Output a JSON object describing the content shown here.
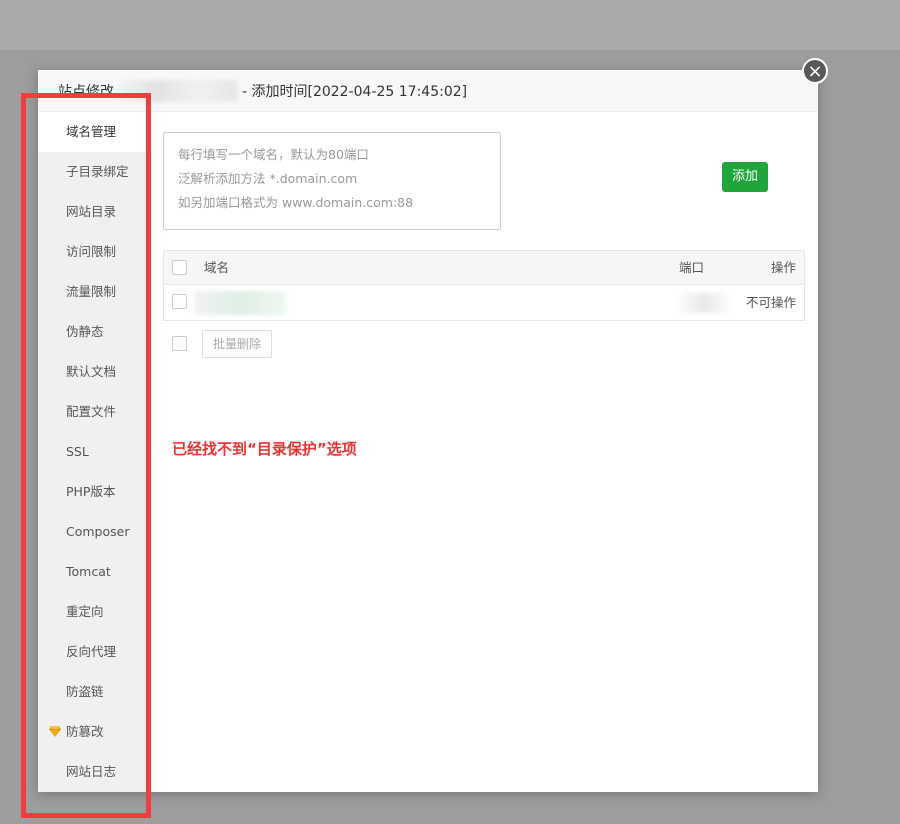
{
  "dialog": {
    "title_prefix": "站点修改",
    "title_suffix": "- 添加时间[2022-04-25 17:45:02]",
    "close_icon": "×"
  },
  "sidebar": {
    "items": [
      {
        "label": "域名管理"
      },
      {
        "label": "子目录绑定"
      },
      {
        "label": "网站目录"
      },
      {
        "label": "访问限制"
      },
      {
        "label": "流量限制"
      },
      {
        "label": "伪静态"
      },
      {
        "label": "默认文档"
      },
      {
        "label": "配置文件"
      },
      {
        "label": "SSL"
      },
      {
        "label": "PHP版本"
      },
      {
        "label": "Composer"
      },
      {
        "label": "Tomcat"
      },
      {
        "label": "重定向"
      },
      {
        "label": "反向代理"
      },
      {
        "label": "防盗链"
      },
      {
        "label": "防篡改",
        "icon": "gem-icon"
      },
      {
        "label": "网站日志"
      }
    ]
  },
  "domain_input": {
    "placeholder_lines": [
      "每行填写一个域名，默认为80端口",
      "泛解析添加方法 *.domain.com",
      "如另加端口格式为 www.domain.com:88"
    ]
  },
  "add_button": "添加",
  "table": {
    "headers": {
      "domain": "域名",
      "port": "端口",
      "action": "操作"
    },
    "rows": [
      {
        "action": "不可操作"
      }
    ]
  },
  "bulk_delete": "批量删除",
  "annotation": "已经找不到“目录保护”选项",
  "colors": {
    "accent": "#20a53a",
    "annotation": "#ee3e3e"
  }
}
